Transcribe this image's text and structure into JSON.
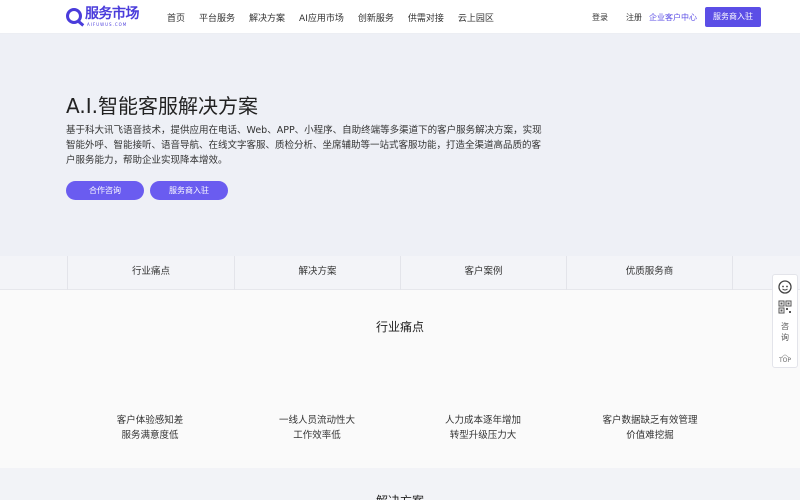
{
  "header": {
    "logo_text": "服务市场",
    "logo_sub": "AIFUWUS.COM",
    "nav": [
      "首页",
      "平台服务",
      "解决方案",
      "AI应用市场",
      "创新服务",
      "供需对接",
      "云上园区"
    ],
    "login": "登录",
    "register": "注册",
    "customer_center": "企业客户中心",
    "join_button": "服务商入驻"
  },
  "hero": {
    "title": "A.I.智能客服解决方案",
    "description": "基于科大讯飞语音技术，提供应用在电话、Web、APP、小程序、自助终端等多渠道下的客户服务解决方案，实现智能外呼、智能接听、语音导航、在线文字客服、质检分析、坐席辅助等一站式客服功能，打造全渠道高品质的客户服务能力，帮助企业实现降本增效。",
    "btn_consult": "合作咨询",
    "btn_join": "服务商入驻"
  },
  "tabs": [
    "行业痛点",
    "解决方案",
    "客户案例",
    "优质服务商"
  ],
  "pain_points": {
    "title": "行业痛点",
    "items": [
      {
        "line1": "客户体验感知差",
        "line2": "服务满意度低"
      },
      {
        "line1": "一线人员流动性大",
        "line2": "工作效率低"
      },
      {
        "line1": "人力成本逐年增加",
        "line2": "转型升级压力大"
      },
      {
        "line1": "客户数据缺乏有效管理",
        "line2": "价值难挖掘"
      }
    ]
  },
  "next_section": {
    "title": "解决方案"
  },
  "float_bar": {
    "consult": "咨询",
    "top": "TOP",
    "icons": [
      "customer-service-icon",
      "qr-code-icon",
      "arrow-up-icon"
    ]
  },
  "colors": {
    "brand": "#4a3cdb",
    "accent": "#5b4ee6",
    "hero_button": "#6a5cf0"
  }
}
